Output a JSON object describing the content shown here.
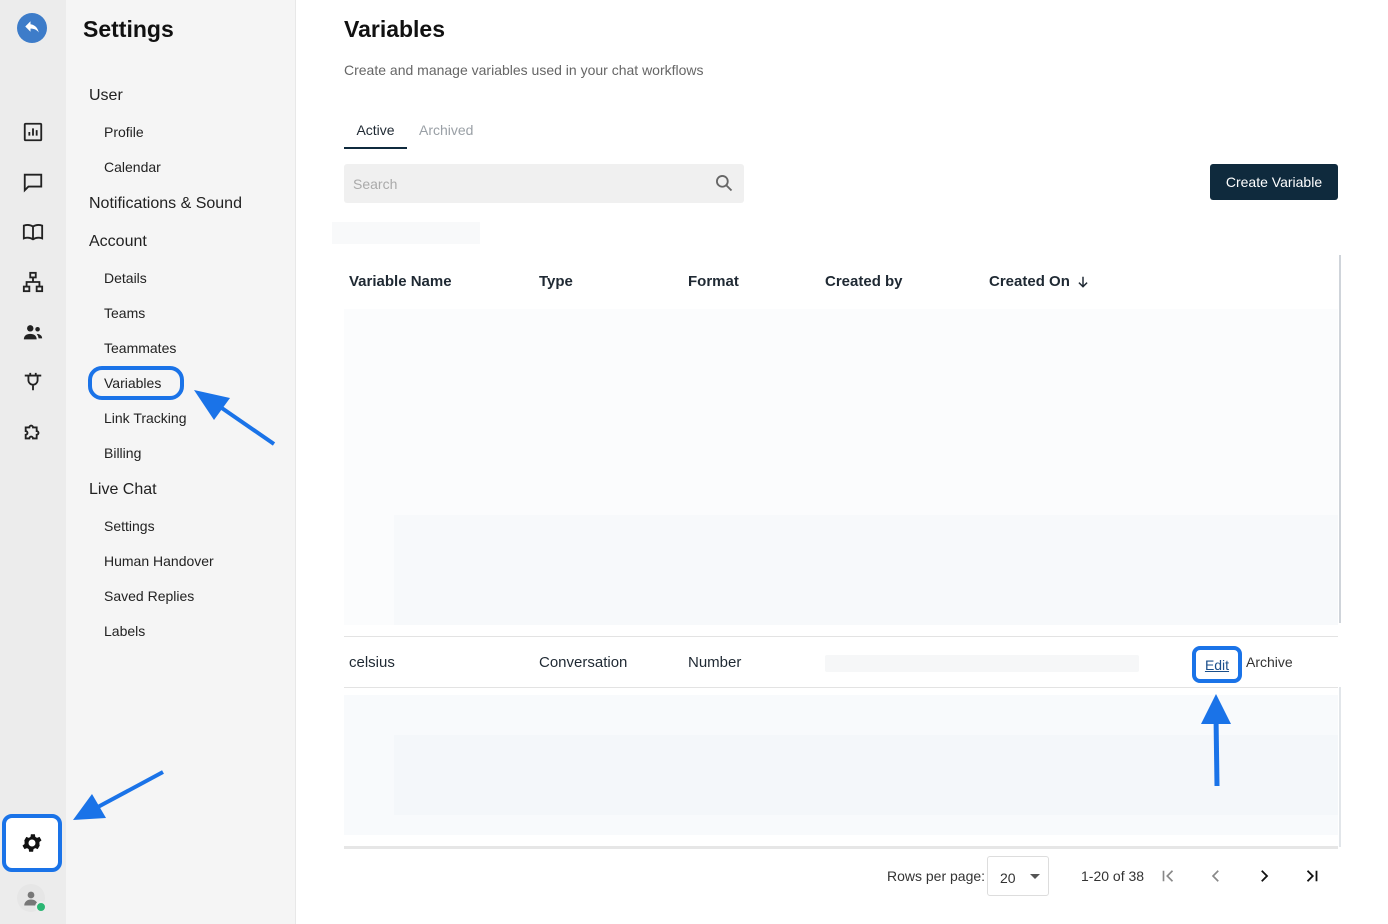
{
  "rail": {
    "back_icon": "back-arrow-icon",
    "icons": [
      "reports-icon",
      "chat-icon",
      "book-icon",
      "sitemap-icon",
      "contacts-icon",
      "plug-icon",
      "puzzle-icon"
    ],
    "settings_icon": "gear-icon",
    "avatar_icon": "user-avatar-icon",
    "status_color": "#2bb673"
  },
  "settings_nav": {
    "title": "Settings",
    "user_group": "User",
    "user_items": [
      "Profile",
      "Calendar"
    ],
    "notifications_group": "Notifications & Sound",
    "account_group": "Account",
    "account_items": [
      "Details",
      "Teams",
      "Teammates",
      "Variables",
      "Link Tracking",
      "Billing"
    ],
    "live_chat_group": "Live Chat",
    "live_chat_items": [
      "Settings",
      "Human Handover",
      "Saved Replies",
      "Labels"
    ]
  },
  "page": {
    "title": "Variables",
    "subtitle": "Create and manage variables used in your chat workflows",
    "tabs": [
      "Active",
      "Archived"
    ],
    "active_tab": "Active",
    "search_placeholder": "Search",
    "create_button": "Create Variable"
  },
  "table": {
    "columns": [
      "Variable Name",
      "Type",
      "Format",
      "Created by",
      "Created On"
    ],
    "sort_column": "Created On",
    "sort_direction": "descending",
    "rows": [
      {
        "name": "celsius",
        "type": "Conversation",
        "format": "Number",
        "created_by": "",
        "created_on": "",
        "actions": [
          "Edit",
          "Archive"
        ]
      }
    ]
  },
  "pagination": {
    "rows_per_page_label": "Rows per page:",
    "rows_per_page": "20",
    "range": "1-20 of 38"
  },
  "colors": {
    "accent": "#1a73e8",
    "primary_button": "#0f2a3d"
  }
}
